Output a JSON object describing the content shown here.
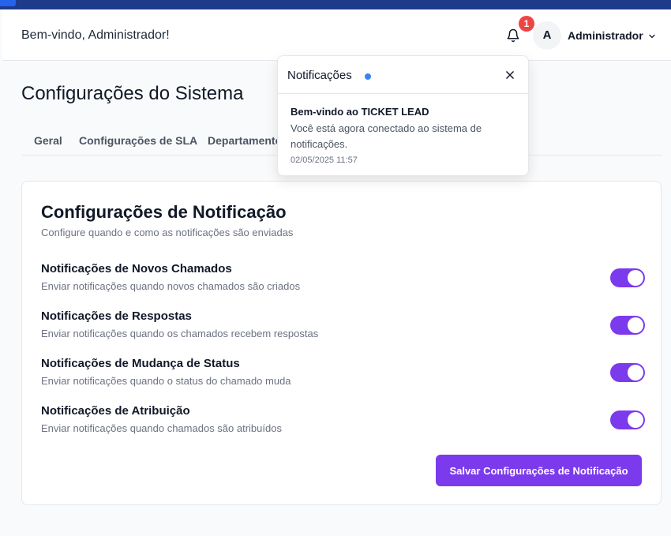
{
  "colors": {
    "accent": "#7c3aed",
    "topbar": "#1e3a8a",
    "badge": "#ef4444",
    "notification_dot": "#3b82f6"
  },
  "header": {
    "welcome": "Bem-vindo, Administrador!",
    "notification_count": "1",
    "avatar_initial": "A",
    "username": "Administrador",
    "icons": {
      "bell": "bell-icon",
      "user_menu": "chevron-down-icon"
    }
  },
  "page": {
    "title": "Configurações do Sistema",
    "tabs": [
      {
        "label": "Geral"
      },
      {
        "label": "Configurações de SLA"
      },
      {
        "label": "Departamentos"
      }
    ]
  },
  "card": {
    "title": "Configurações de Notificação",
    "subtitle": "Configure quando e como as notificações são enviadas",
    "settings": [
      {
        "title": "Notificações de Novos Chamados",
        "description": "Enviar notificações quando novos chamados são criados",
        "enabled": true
      },
      {
        "title": "Notificações de Respostas",
        "description": "Enviar notificações quando os chamados recebem respostas",
        "enabled": true
      },
      {
        "title": "Notificações de Mudança de Status",
        "description": "Enviar notificações quando o status do chamado muda",
        "enabled": true
      },
      {
        "title": "Notificações de Atribuição",
        "description": "Enviar notificações quando chamados são atribuídos",
        "enabled": true
      }
    ],
    "save_label": "Salvar Configurações de Notificação"
  },
  "popover": {
    "title": "Notificações",
    "close_icon": "close-icon",
    "notifications": [
      {
        "title": "Bem-vindo ao TICKET LEAD",
        "message": "Você está agora conectado ao sistema de notificações.",
        "time": "02/05/2025 11:57"
      }
    ]
  }
}
